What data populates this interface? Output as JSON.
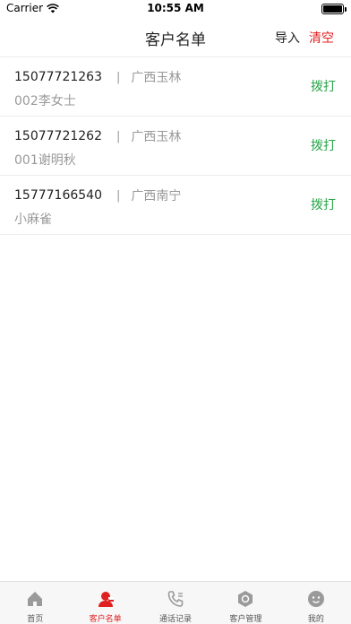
{
  "status_bar": {
    "carrier": "Carrier",
    "time": "10:55 AM"
  },
  "nav": {
    "title": "客户名单",
    "import_label": "导入",
    "clear_label": "清空"
  },
  "customers": [
    {
      "phone": "15077721263",
      "separator": "|",
      "region": "广西玉林",
      "name": "002李女士",
      "action": "拨打"
    },
    {
      "phone": "15077721262",
      "separator": "|",
      "region": "广西玉林",
      "name": "001谢明秋",
      "action": "拨打"
    },
    {
      "phone": "15777166540",
      "separator": "|",
      "region": "广西南宁",
      "name": "小麻雀",
      "action": "拨打"
    }
  ],
  "tabs": [
    {
      "label": "首页",
      "icon": "home-icon",
      "active": false
    },
    {
      "label": "客户名单",
      "icon": "customer-list-icon",
      "active": true
    },
    {
      "label": "通话记录",
      "icon": "call-log-icon",
      "active": false
    },
    {
      "label": "客户管理",
      "icon": "customer-manage-icon",
      "active": false
    },
    {
      "label": "我的",
      "icon": "profile-icon",
      "active": false
    }
  ],
  "colors": {
    "accent_red": "#e02020",
    "call_green": "#2aa54a",
    "secondary_text": "#999999"
  }
}
